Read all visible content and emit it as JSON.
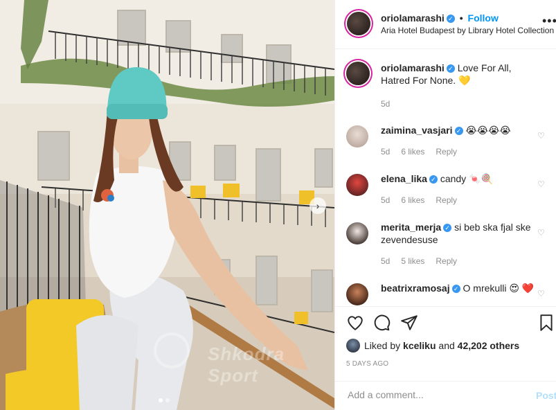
{
  "post": {
    "username": "oriolamarashi",
    "follow_separator": "•",
    "follow_label": "Follow",
    "location": "Aria Hotel Budapest by Library Hotel Collection",
    "more_label": "•••",
    "carousel_next_label": "›",
    "watermark_text": "Shkodra Sport"
  },
  "caption": {
    "username": "oriolamarashi",
    "text": "Love For All, Hatred For None. 💛",
    "age": "5d"
  },
  "comments": [
    {
      "username": "zaimina_vasjari",
      "text": "😭😭😭😭",
      "age": "5d",
      "likes": "6 likes",
      "reply": "Reply"
    },
    {
      "username": "elena_lika",
      "text": "candy 🍬🍭",
      "age": "5d",
      "likes": "6 likes",
      "reply": "Reply"
    },
    {
      "username": "merita_merja",
      "text": "si beb ska fjal ske zevendesuse",
      "age": "5d",
      "likes": "5 likes",
      "reply": "Reply"
    },
    {
      "username": "beatrixramosaj",
      "text": "O mrekulli 😍 ❤️",
      "age": "",
      "likes": "",
      "reply": ""
    }
  ],
  "likes": {
    "prefix": "Liked by",
    "user": "kceliku",
    "joiner": "and",
    "others": "42,202 others"
  },
  "timestamp": "5 DAYS AGO",
  "composer": {
    "placeholder": "Add a comment...",
    "post_label": "Post"
  },
  "colors": {
    "accent": "#0095f6",
    "verified": "#3897f0",
    "muted": "#8e8e8e",
    "post_disabled": "#b2dffc",
    "beanie": "#5fc9c4",
    "pillow": "#f3c928"
  },
  "icons": [
    "verified-badge-icon",
    "more-options-icon",
    "heart-icon",
    "comment-icon",
    "share-icon",
    "bookmark-icon",
    "carousel-next-icon"
  ]
}
